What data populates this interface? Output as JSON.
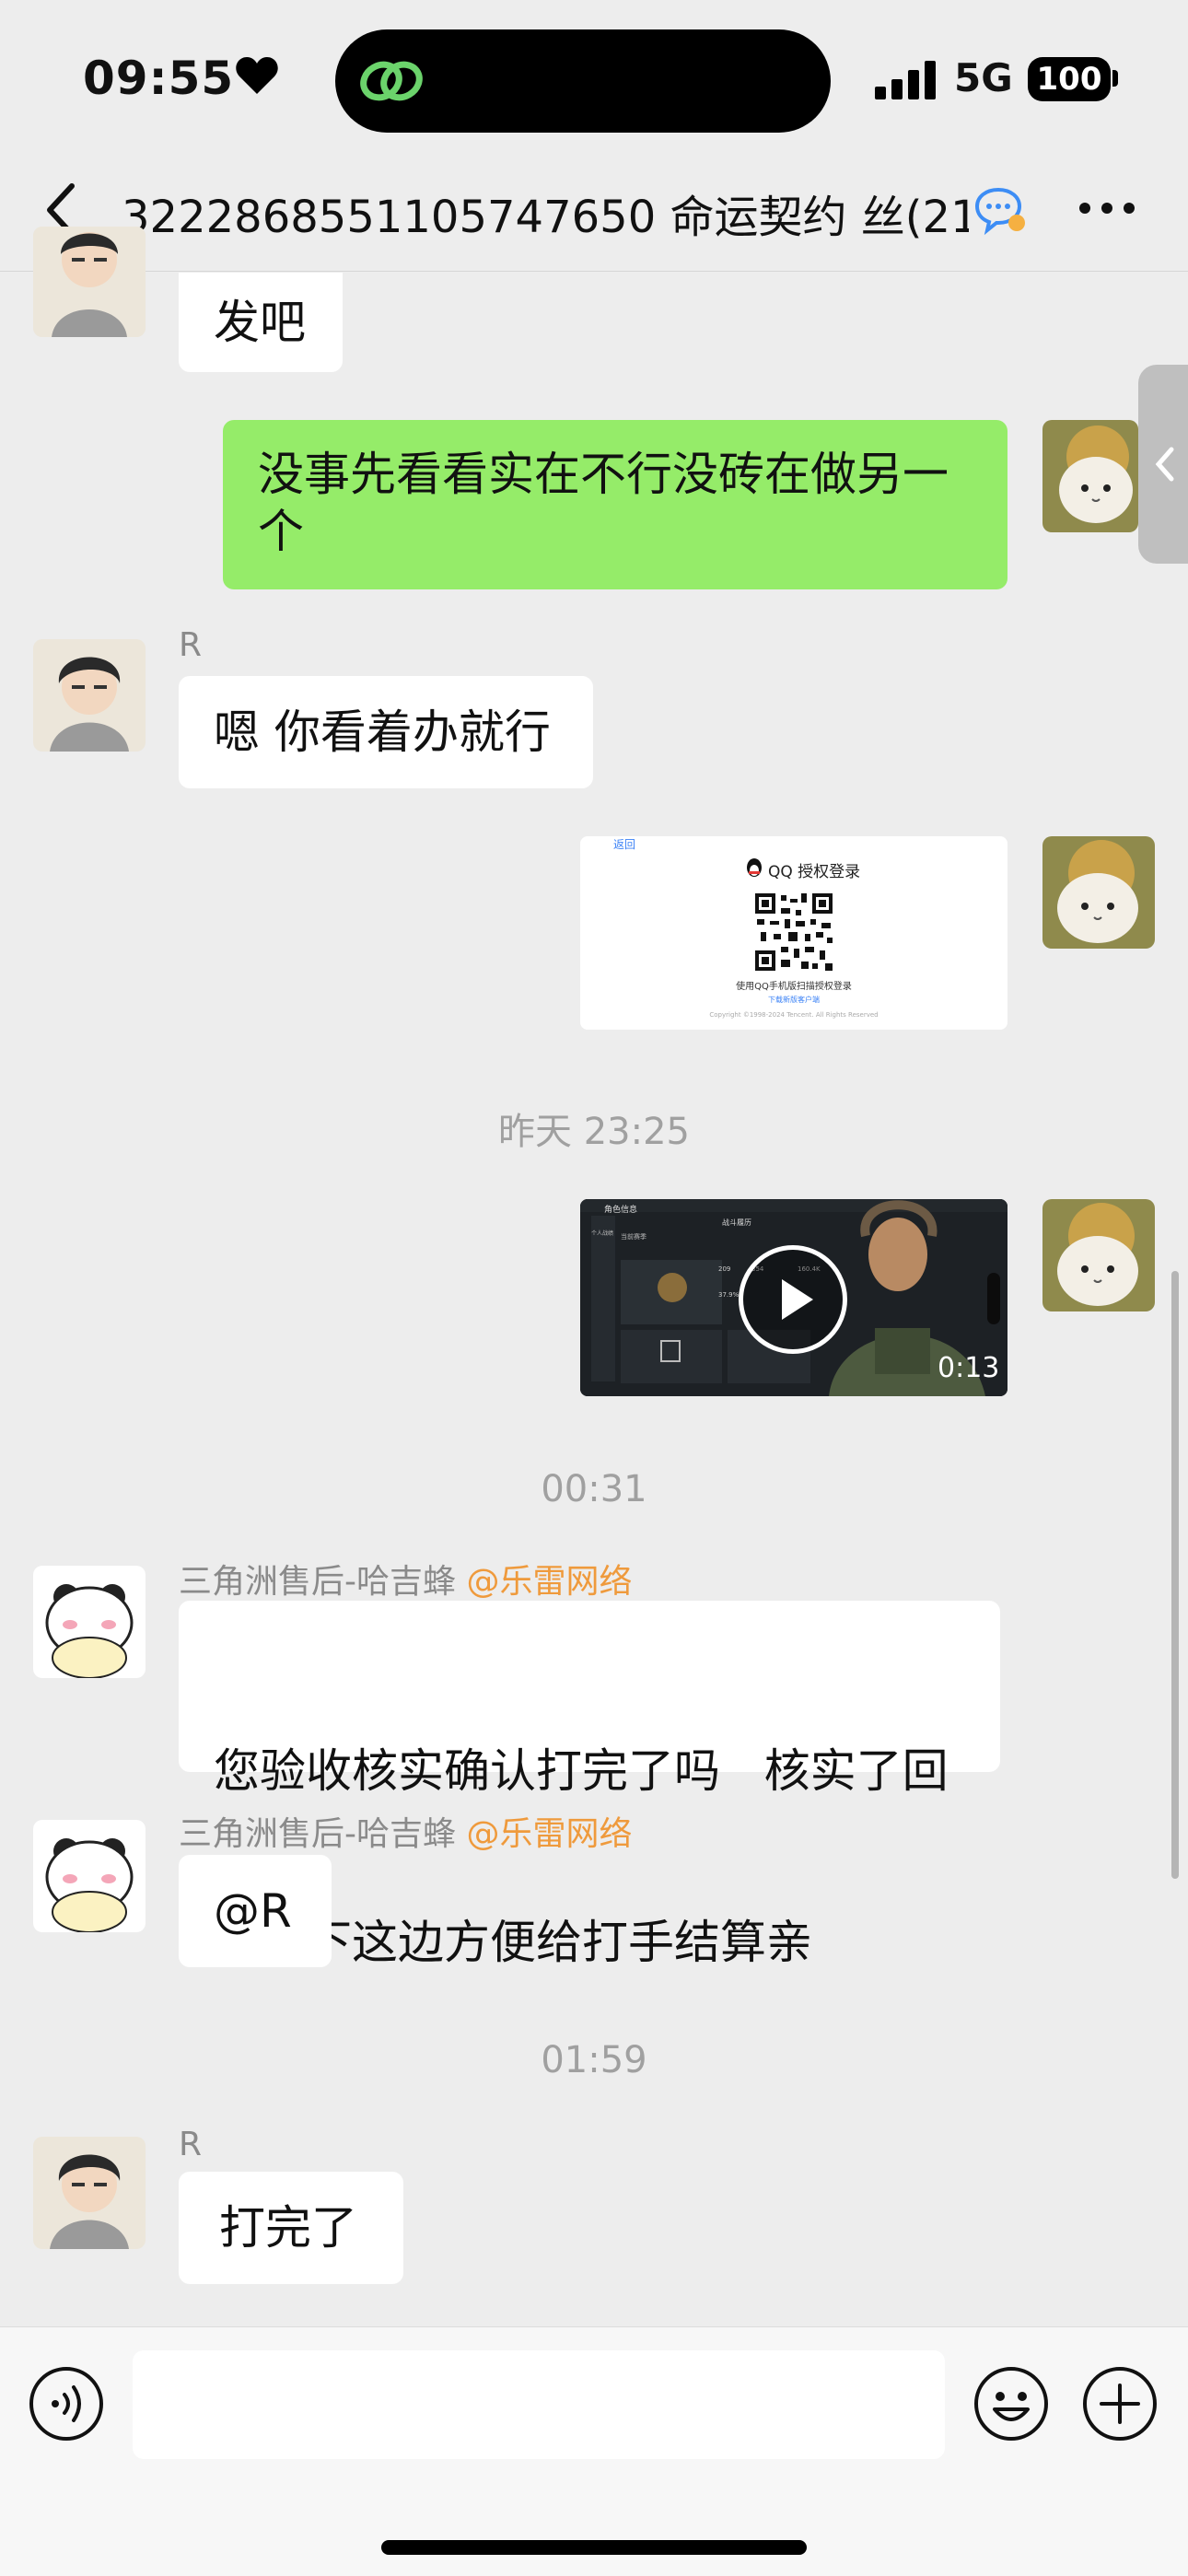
{
  "status": {
    "time": "09:55",
    "network": "5G",
    "battery": "100"
  },
  "nav": {
    "title": "3222868551105747650 命运契约 丝(21)"
  },
  "messages": {
    "m1_text": "发吧",
    "m2_text": "没事先看看实在不行没砖在做另一个",
    "m3_sender": "R",
    "m3_text": "嗯 你看着办就行",
    "qq_login": {
      "back": "返回",
      "title": "QQ 授权登录",
      "hint": "使用QQ手机版扫描授权登录",
      "download": "下载新版客户端",
      "copyright": "Copyright ©1998-2024 Tencent. All Rights Reserved"
    },
    "ts1": "昨天 23:25",
    "video": {
      "duration": "0:13",
      "header": "角色信息",
      "tab": "战斗履历",
      "tab_left": "个人战绩",
      "sub": "当前赛季",
      "stat1": "209",
      "stat2": "37.9%",
      "stat3": "354",
      "stat4": "160.4K"
    },
    "ts2": "00:31",
    "m4_sender": "三角洲售后-哈吉蜂",
    "m4_at": "@乐雷网络",
    "m4_text_line1": "您验收核实确认打完了吗   核实了回",
    "m4_text_line2": "复一下这边方便给打手结算亲",
    "m5_sender": "三角洲售后-哈吉蜂",
    "m5_at": "@乐雷网络",
    "m5_text": "@R",
    "ts3": "01:59",
    "m6_sender": "R",
    "m6_text": "打完了"
  },
  "icons": {
    "back": "chevron-left-icon",
    "more": "more-dots-icon",
    "voice": "voice-icon",
    "emoji": "emoji-icon",
    "plus": "plus-icon"
  },
  "colors": {
    "green_bubble": "#95ec69",
    "mention": "#ef9a3c",
    "background": "#ededed"
  }
}
